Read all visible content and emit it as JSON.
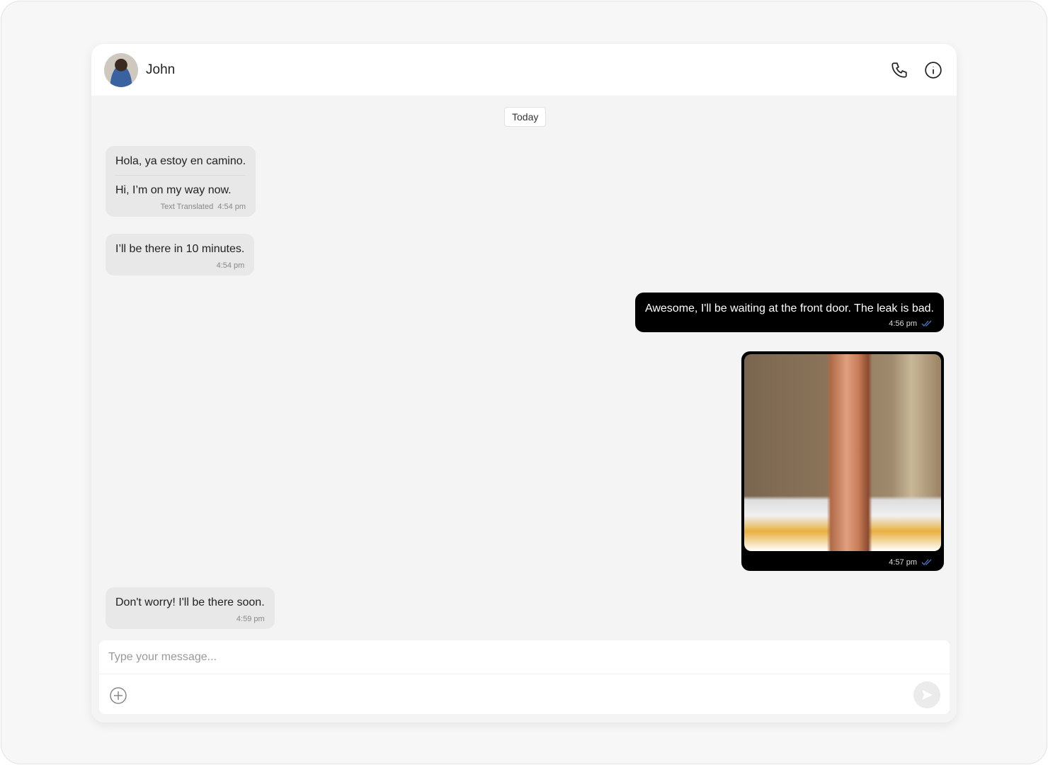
{
  "contact": {
    "name": "John"
  },
  "date_chip": "Today",
  "messages": [
    {
      "text": "Hola, ya estoy en camino.",
      "translation": "Hi, I’m on my way now.",
      "translated_label": "Text Translated",
      "time": "4:54 pm"
    },
    {
      "text": "I’ll be there in 10 minutes.",
      "time": "4:54 pm"
    },
    {
      "text": "Awesome, I'll be waiting at the front door. The leak is bad.",
      "time": "4:56 pm"
    },
    {
      "time": "4:57 pm"
    },
    {
      "text": "Don't worry! I'll be there soon.",
      "time": "4:59 pm"
    }
  ],
  "composer": {
    "placeholder": "Type your message..."
  },
  "colors": {
    "read_check": "#4a78c8",
    "outgoing_bg": "#000000",
    "incoming_bg": "#e8e8e8"
  }
}
